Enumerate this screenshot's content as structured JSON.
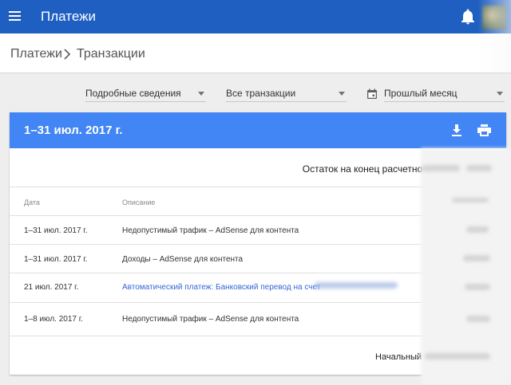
{
  "appbar": {
    "title": "Платежи",
    "color": "#1e5fc1",
    "menu_icon": "menu-icon",
    "bell_icon": "notifications-bell-icon"
  },
  "breadcrumb": {
    "root": "Платежи",
    "current": "Транзакции"
  },
  "filters": {
    "detail": "Подробные сведения",
    "transactions": "Все транзакции",
    "period": "Прошлый месяц"
  },
  "card": {
    "period": "1–31 июл. 2017 г.",
    "header_color": "#4285f4",
    "ending_balance_label": "Остаток на конец расчетного",
    "columns": {
      "date": "Дата",
      "description": "Описание"
    },
    "rows": [
      {
        "date": "1–31 июл. 2017 г.",
        "description": "Недопустимый трафик – AdSense для контента",
        "link": false
      },
      {
        "date": "1–31 июл. 2017 г.",
        "description": "Доходы – AdSense для контента",
        "link": false
      },
      {
        "date": "21 июл. 2017 г.",
        "description": "Автоматический платеж: Банковский перевод на счет",
        "link": true
      },
      {
        "date": "1–8 июл. 2017 г.",
        "description": "Недопустимый трафик – AdSense для контента",
        "link": false
      }
    ],
    "starting_balance_label": "Начальный"
  }
}
